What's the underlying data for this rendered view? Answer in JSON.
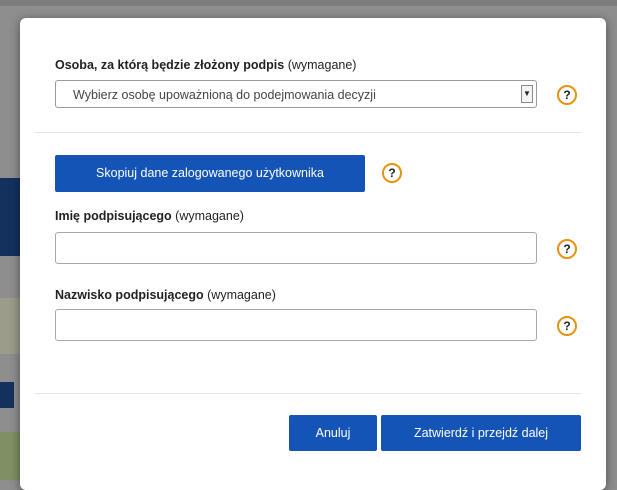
{
  "dialog": {
    "signer_section": {
      "label": "Osoba, za którą będzie złożony podpis",
      "required": "(wymagane)",
      "select_value": "Wybierz osobę upoważnioną do podejmowania decyzji",
      "help_glyph": "?"
    },
    "copy_button": "Skopiuj dane zalogowanego użytkownika",
    "first_name": {
      "label": "Imię podpisującego",
      "required": "(wymagane)",
      "value": "",
      "help_glyph": "?"
    },
    "last_name": {
      "label": "Nazwisko podpisującego",
      "required": "(wymagane)",
      "value": "",
      "help_glyph": "?"
    },
    "buttons": {
      "cancel": "Anuluj",
      "confirm": "Zatwierdź i przejdź dalej"
    }
  },
  "colors": {
    "primary_button": "#1554b7",
    "help_ring": "#e6930f"
  },
  "icons": {
    "help": "question-circle-icon",
    "select_arrow": "chevron-down-icon"
  }
}
